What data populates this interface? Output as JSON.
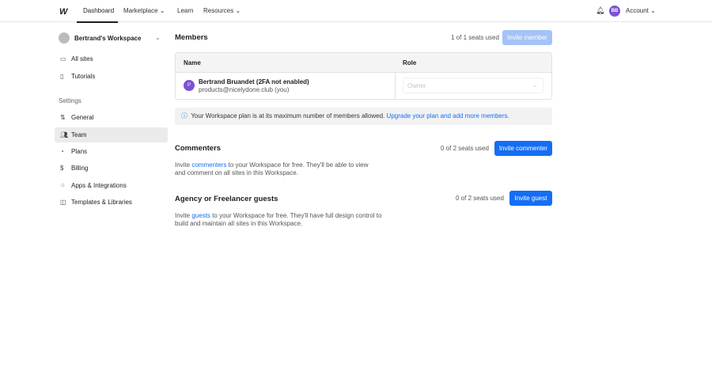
{
  "topnav": {
    "items": [
      "Dashboard",
      "Marketplace",
      "Learn",
      "Resources"
    ],
    "account": "Account",
    "avatar": "BB"
  },
  "sidebar": {
    "workspace": "Bertrand's Workspace",
    "top_items": [
      "All sites",
      "Tutorials"
    ],
    "settings_label": "Settings",
    "items": [
      "General",
      "Team",
      "Plans",
      "Billing",
      "Apps & Integrations",
      "Templates & Libraries"
    ],
    "selected": "Team"
  },
  "members": {
    "title": "Members",
    "seats": "1 of 1 seats used",
    "button": "Invite member",
    "col_name": "Name",
    "col_role": "Role",
    "member": {
      "initial": "P",
      "name": "Bertrand Bruandet (2FA not enabled)",
      "email": "products@nicelydone.club (you)",
      "role": "Owner"
    },
    "notice": "Your Workspace plan is at its maximum number of members allowed.",
    "notice_link": "Upgrade your plan and add more members."
  },
  "commenters": {
    "title": "Commenters",
    "seats": "0 of 2 seats used",
    "button": "Invite commenter",
    "desc_pre": "Invite",
    "desc_link": "commenters",
    "desc_post": "to your Workspace for free. They'll be able to view and comment on all sites in this Workspace."
  },
  "guests": {
    "title": "Agency or Freelancer guests",
    "seats": "0 of 2 seats used",
    "button": "Invite guest",
    "desc_pre": "Invite",
    "desc_link": "guests",
    "desc_post": "to your Workspace for free. They'll have full design control to build and maintain all sites in this Workspace."
  },
  "colors": {
    "accent": "#146ef5",
    "avatar": "#7b52d6"
  }
}
